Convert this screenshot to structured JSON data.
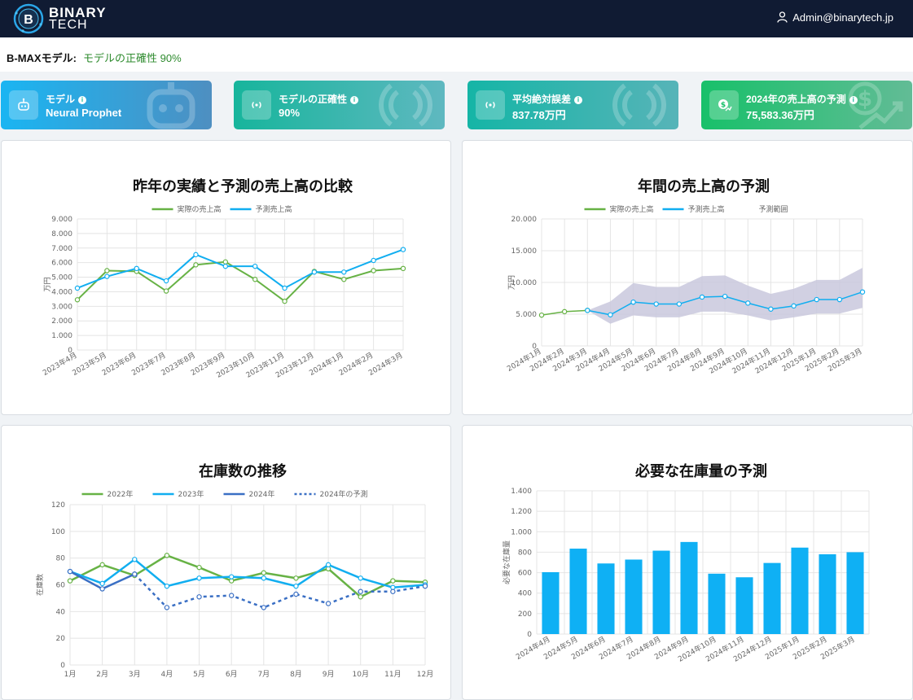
{
  "header": {
    "logo_line1": "BINARY",
    "logo_line2": "TECH",
    "user_email": "Admin@binarytech.jp"
  },
  "model_info": {
    "label": "B-MAXモデル:",
    "value": "モデルの正確性 90%"
  },
  "kpis": [
    {
      "title": "モデル",
      "value": "Neural Prophet",
      "color_from": "#1ab5f2",
      "color_to": "#4e8fc1",
      "icon": "robot-icon"
    },
    {
      "title": "モデルの正確性",
      "value": "90%",
      "color_from": "#17b59c",
      "color_to": "#5fb8c0",
      "icon": "signal-icon"
    },
    {
      "title": "平均絶対誤差",
      "value": "837.78万円",
      "color_from": "#15b5a6",
      "color_to": "#57b4b8",
      "icon": "signal-icon"
    },
    {
      "title": "2024年の売上高の予測",
      "value": "75,583.36万円",
      "color_from": "#18c06a",
      "color_to": "#62bc96",
      "icon": "money-growth-icon"
    }
  ],
  "colors": {
    "green": "#67b245",
    "blue": "#11aef0",
    "navy": "#3a6fc4",
    "band": "#c9c8dd",
    "bar": "#0fb0f4"
  },
  "chart_data": [
    {
      "type": "line",
      "title": "昨年の実績と予測の売上高の比較",
      "ylabel": "万円",
      "ylim": [
        0,
        9000
      ],
      "yticks": [
        "0",
        "1.000",
        "2.000",
        "3.000",
        "4.000",
        "5.000",
        "6.000",
        "7.000",
        "8.000",
        "9.000"
      ],
      "categories": [
        "2023年4月",
        "2023年5月",
        "2023年6月",
        "2023年7月",
        "2023年8月",
        "2023年9月",
        "2023年10月",
        "2023年11月",
        "2023年12月",
        "2024年1月",
        "2024年2月",
        "2024年3月"
      ],
      "series": [
        {
          "name": "実際の売上高",
          "values": [
            3450,
            5450,
            5400,
            4050,
            5850,
            6050,
            4850,
            3350,
            5400,
            4850,
            5450,
            5600
          ]
        },
        {
          "name": "予測売上高",
          "values": [
            4250,
            5050,
            5600,
            4750,
            6550,
            5750,
            5750,
            4250,
            5350,
            5350,
            6150,
            6900
          ]
        }
      ]
    },
    {
      "type": "area",
      "title": "年間の売上高の予測",
      "ylabel": "万円",
      "ylim": [
        0,
        20000
      ],
      "yticks": [
        "0",
        "5.000",
        "10.000",
        "15.000",
        "20.000"
      ],
      "categories": [
        "2024年1月",
        "2024年2月",
        "2024年3月",
        "2024年4月",
        "2024年5月",
        "2024年6月",
        "2024年7月",
        "2024年8月",
        "2024年9月",
        "2024年10月",
        "2024年11月",
        "2024年12月",
        "2025年1月",
        "2025年2月",
        "2025年3月"
      ],
      "series": [
        {
          "name": "実際の売上高",
          "values": [
            4850,
            5400,
            5600,
            null,
            null,
            null,
            null,
            null,
            null,
            null,
            null,
            null,
            null,
            null,
            null
          ]
        },
        {
          "name": "予測売上高",
          "values": [
            null,
            null,
            5600,
            4900,
            6900,
            6600,
            6600,
            7700,
            7800,
            6750,
            5800,
            6300,
            7300,
            7300,
            8500
          ]
        },
        {
          "name": "予測範囲",
          "lower": [
            null,
            null,
            5600,
            3500,
            4800,
            4500,
            4500,
            5400,
            5400,
            4800,
            4000,
            4500,
            5100,
            5100,
            6000
          ],
          "upper": [
            null,
            null,
            5600,
            7000,
            9900,
            9300,
            9300,
            11000,
            11100,
            9500,
            8200,
            9000,
            10400,
            10400,
            12300
          ]
        }
      ]
    },
    {
      "type": "line",
      "title": "在庫数の推移",
      "ylabel": "在庫数",
      "ylim": [
        0,
        120
      ],
      "yticks": [
        "0",
        "20",
        "40",
        "60",
        "80",
        "100",
        "120"
      ],
      "categories": [
        "1月",
        "2月",
        "3月",
        "4月",
        "5月",
        "6月",
        "7月",
        "8月",
        "9月",
        "10月",
        "11月",
        "12月"
      ],
      "series": [
        {
          "name": "2022年",
          "values": [
            63,
            75,
            67,
            82,
            73,
            63,
            69,
            65,
            72,
            51,
            63,
            62
          ]
        },
        {
          "name": "2023年",
          "values": [
            70,
            61,
            79,
            59,
            65,
            66,
            65,
            59,
            75,
            65,
            58,
            60
          ]
        },
        {
          "name": "2024年",
          "values": [
            70,
            57,
            68,
            null,
            null,
            null,
            null,
            null,
            null,
            null,
            null,
            null
          ]
        },
        {
          "name": "2024年の予測",
          "values": [
            null,
            null,
            68,
            43,
            51,
            52,
            43,
            53,
            46,
            55,
            55,
            59
          ]
        }
      ]
    },
    {
      "type": "bar",
      "title": "必要な在庫量の予測",
      "ylabel": "必要な在庫量",
      "ylim": [
        0,
        1400
      ],
      "yticks": [
        "0",
        "200",
        "400",
        "600",
        "800",
        "1.000",
        "1.200",
        "1.400"
      ],
      "categories": [
        "2024年4月",
        "2024年5月",
        "2024年6月",
        "2024年7月",
        "2024年8月",
        "2024年9月",
        "2024年10月",
        "2024年11月",
        "2024年12月",
        "2025年1月",
        "2025年2月",
        "2025年3月"
      ],
      "values": [
        605,
        835,
        690,
        728,
        815,
        900,
        590,
        555,
        695,
        845,
        780,
        800
      ]
    }
  ]
}
